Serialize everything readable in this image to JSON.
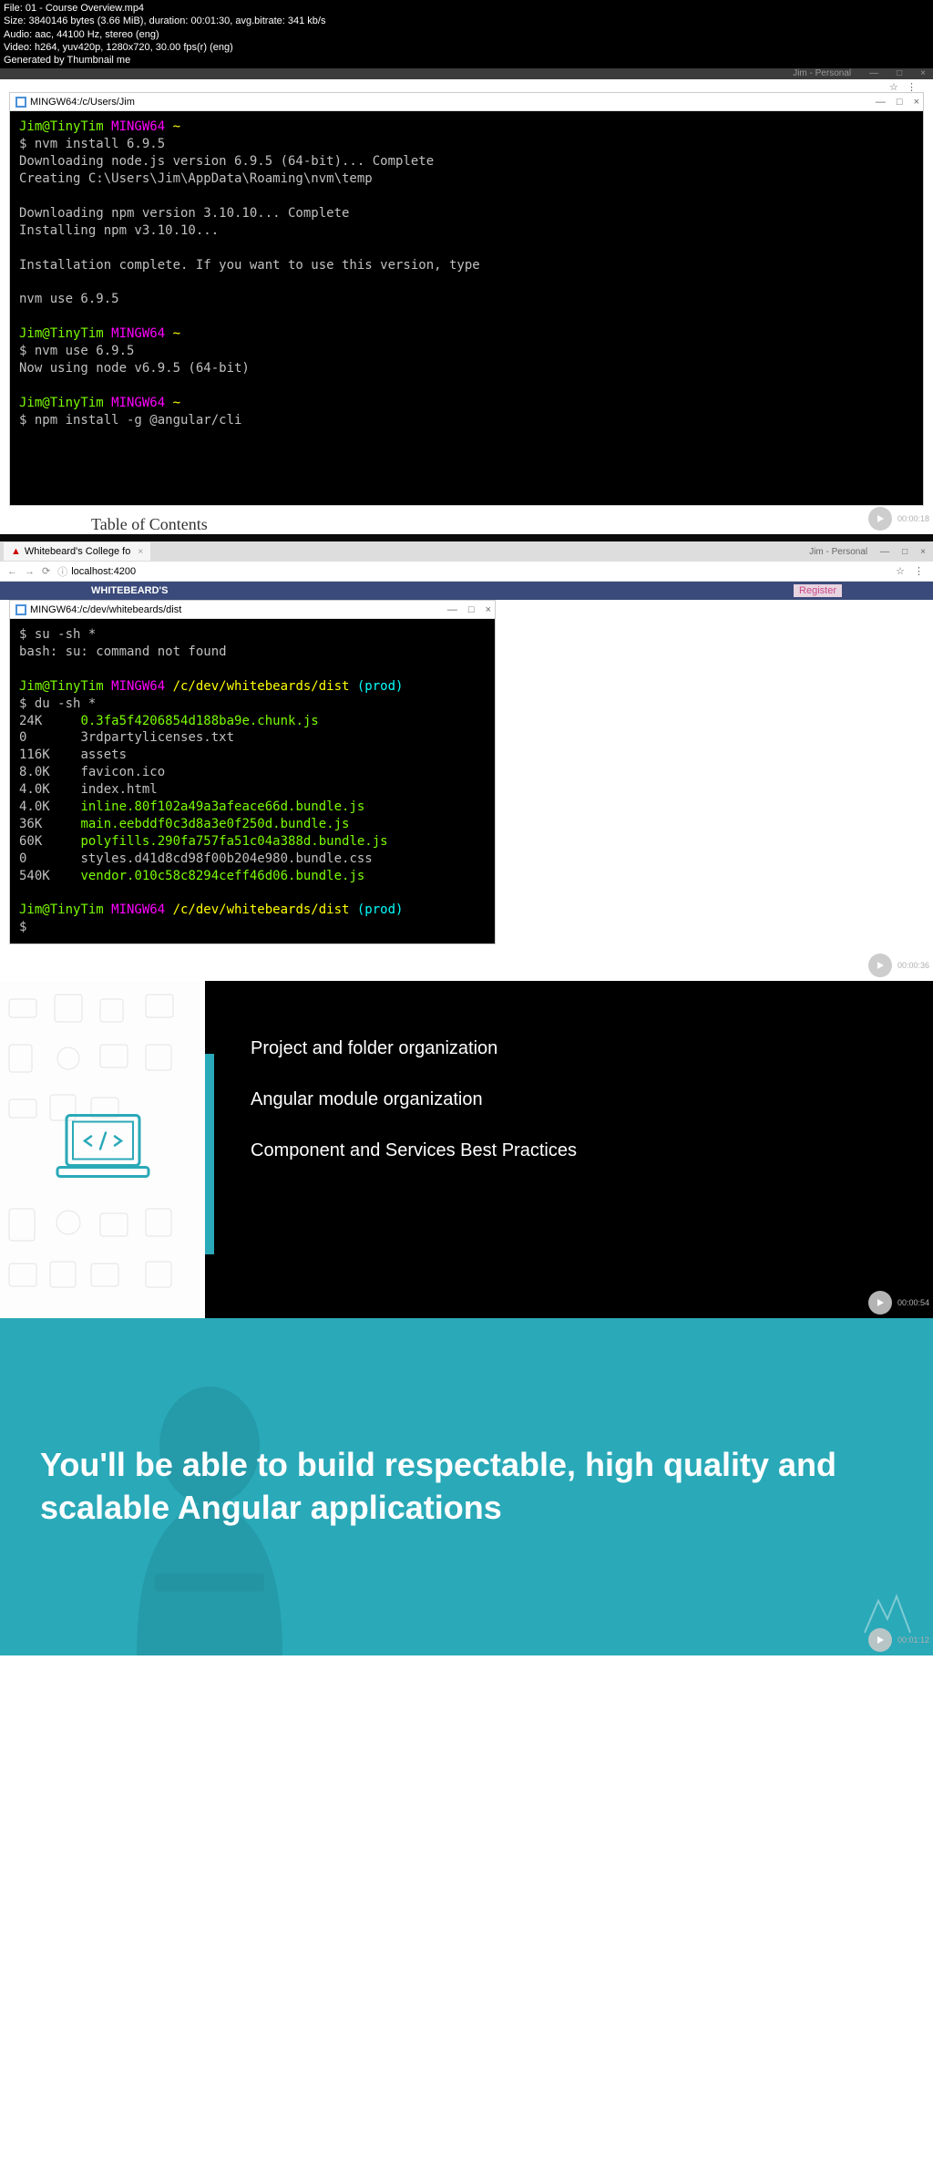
{
  "meta": {
    "file": "File: 01 - Course Overview.mp4",
    "size": "Size: 3840146 bytes (3.66 MiB), duration: 00:01:30, avg.bitrate: 341 kb/s",
    "audio": "Audio: aac, 44100 Hz, stereo (eng)",
    "video": "Video: h264, yuv420p, 1280x720, 30.00 fps(r) (eng)",
    "gen": "Generated by Thumbnail me"
  },
  "browser1": {
    "user": "Jim - Personal",
    "min": "—",
    "max": "□",
    "close": "×"
  },
  "term1": {
    "title": "MINGW64:/c/Users/Jim",
    "min": "—",
    "max": "□",
    "close": "×",
    "p1_user": "Jim@TinyTim",
    "p1_sys": " MINGW64 ",
    "p1_tilde": "~",
    "l1": "$ nvm install 6.9.5",
    "l2": "Downloading node.js version 6.9.5 (64-bit)... Complete",
    "l3": "Creating C:\\Users\\Jim\\AppData\\Roaming\\nvm\\temp",
    "l4": "",
    "l5": "Downloading npm version 3.10.10... Complete",
    "l6": "Installing npm v3.10.10...",
    "l7": "",
    "l8": "Installation complete. If you want to use this version, type",
    "l9": "",
    "l10": "nvm use 6.9.5",
    "l11": "",
    "l12": "$ nvm use 6.9.5",
    "l13": "Now using node v6.9.5 (64-bit)",
    "l14": "",
    "l15": "$ npm install -g @angular/cli"
  },
  "ts1": "00:00:18",
  "toc": "Table of Contents",
  "chrome2": {
    "tab": "Whitebeard's College fo",
    "url": "localhost:4200",
    "user": "Jim - Personal"
  },
  "wb": {
    "brand": "WHITEBEARD'S",
    "register": "Register"
  },
  "term2": {
    "title": "MINGW64:/c/dev/whitebeards/dist",
    "l1": "$ su -sh *",
    "l2": "bash: su: command not found",
    "p_user": "Jim@TinyTim",
    "p_sys": " MINGW64 ",
    "p_path": "/c/dev/whitebeards/dist",
    "p_branch": " (prod)",
    "l3": "$ du -sh *",
    "f1s": "24K     ",
    "f1n": "0.3fa5f4206854d188ba9e.chunk.js",
    "f2s": "0       ",
    "f2n": "3rdpartylicenses.txt",
    "f3s": "116K    ",
    "f3n": "assets",
    "f4s": "8.0K    ",
    "f4n": "favicon.ico",
    "f5s": "4.0K    ",
    "f5n": "index.html",
    "f6s": "4.0K    ",
    "f6n": "inline.80f102a49a3afeace66d.bundle.js",
    "f7s": "36K     ",
    "f7n": "main.eebddf0c3d8a3e0f250d.bundle.js",
    "f8s": "60K     ",
    "f8n": "polyfills.290fa757fa51c04a388d.bundle.js",
    "f9s": "0       ",
    "f9n": "styles.d41d8cd98f00b204e980.bundle.css",
    "f10s": "540K    ",
    "f10n": "vendor.010c58c8294ceff46d06.bundle.js",
    "lend": "$"
  },
  "ts2": "00:00:36",
  "slide3": {
    "l1": "Project and folder organization",
    "l2": "Angular module organization",
    "l3": "Component and Services Best Practices"
  },
  "ts3": "00:00:54",
  "slide4": {
    "text": "You'll be able to build respectable, high quality and scalable Angular applications"
  },
  "ts4": "00:01:12"
}
